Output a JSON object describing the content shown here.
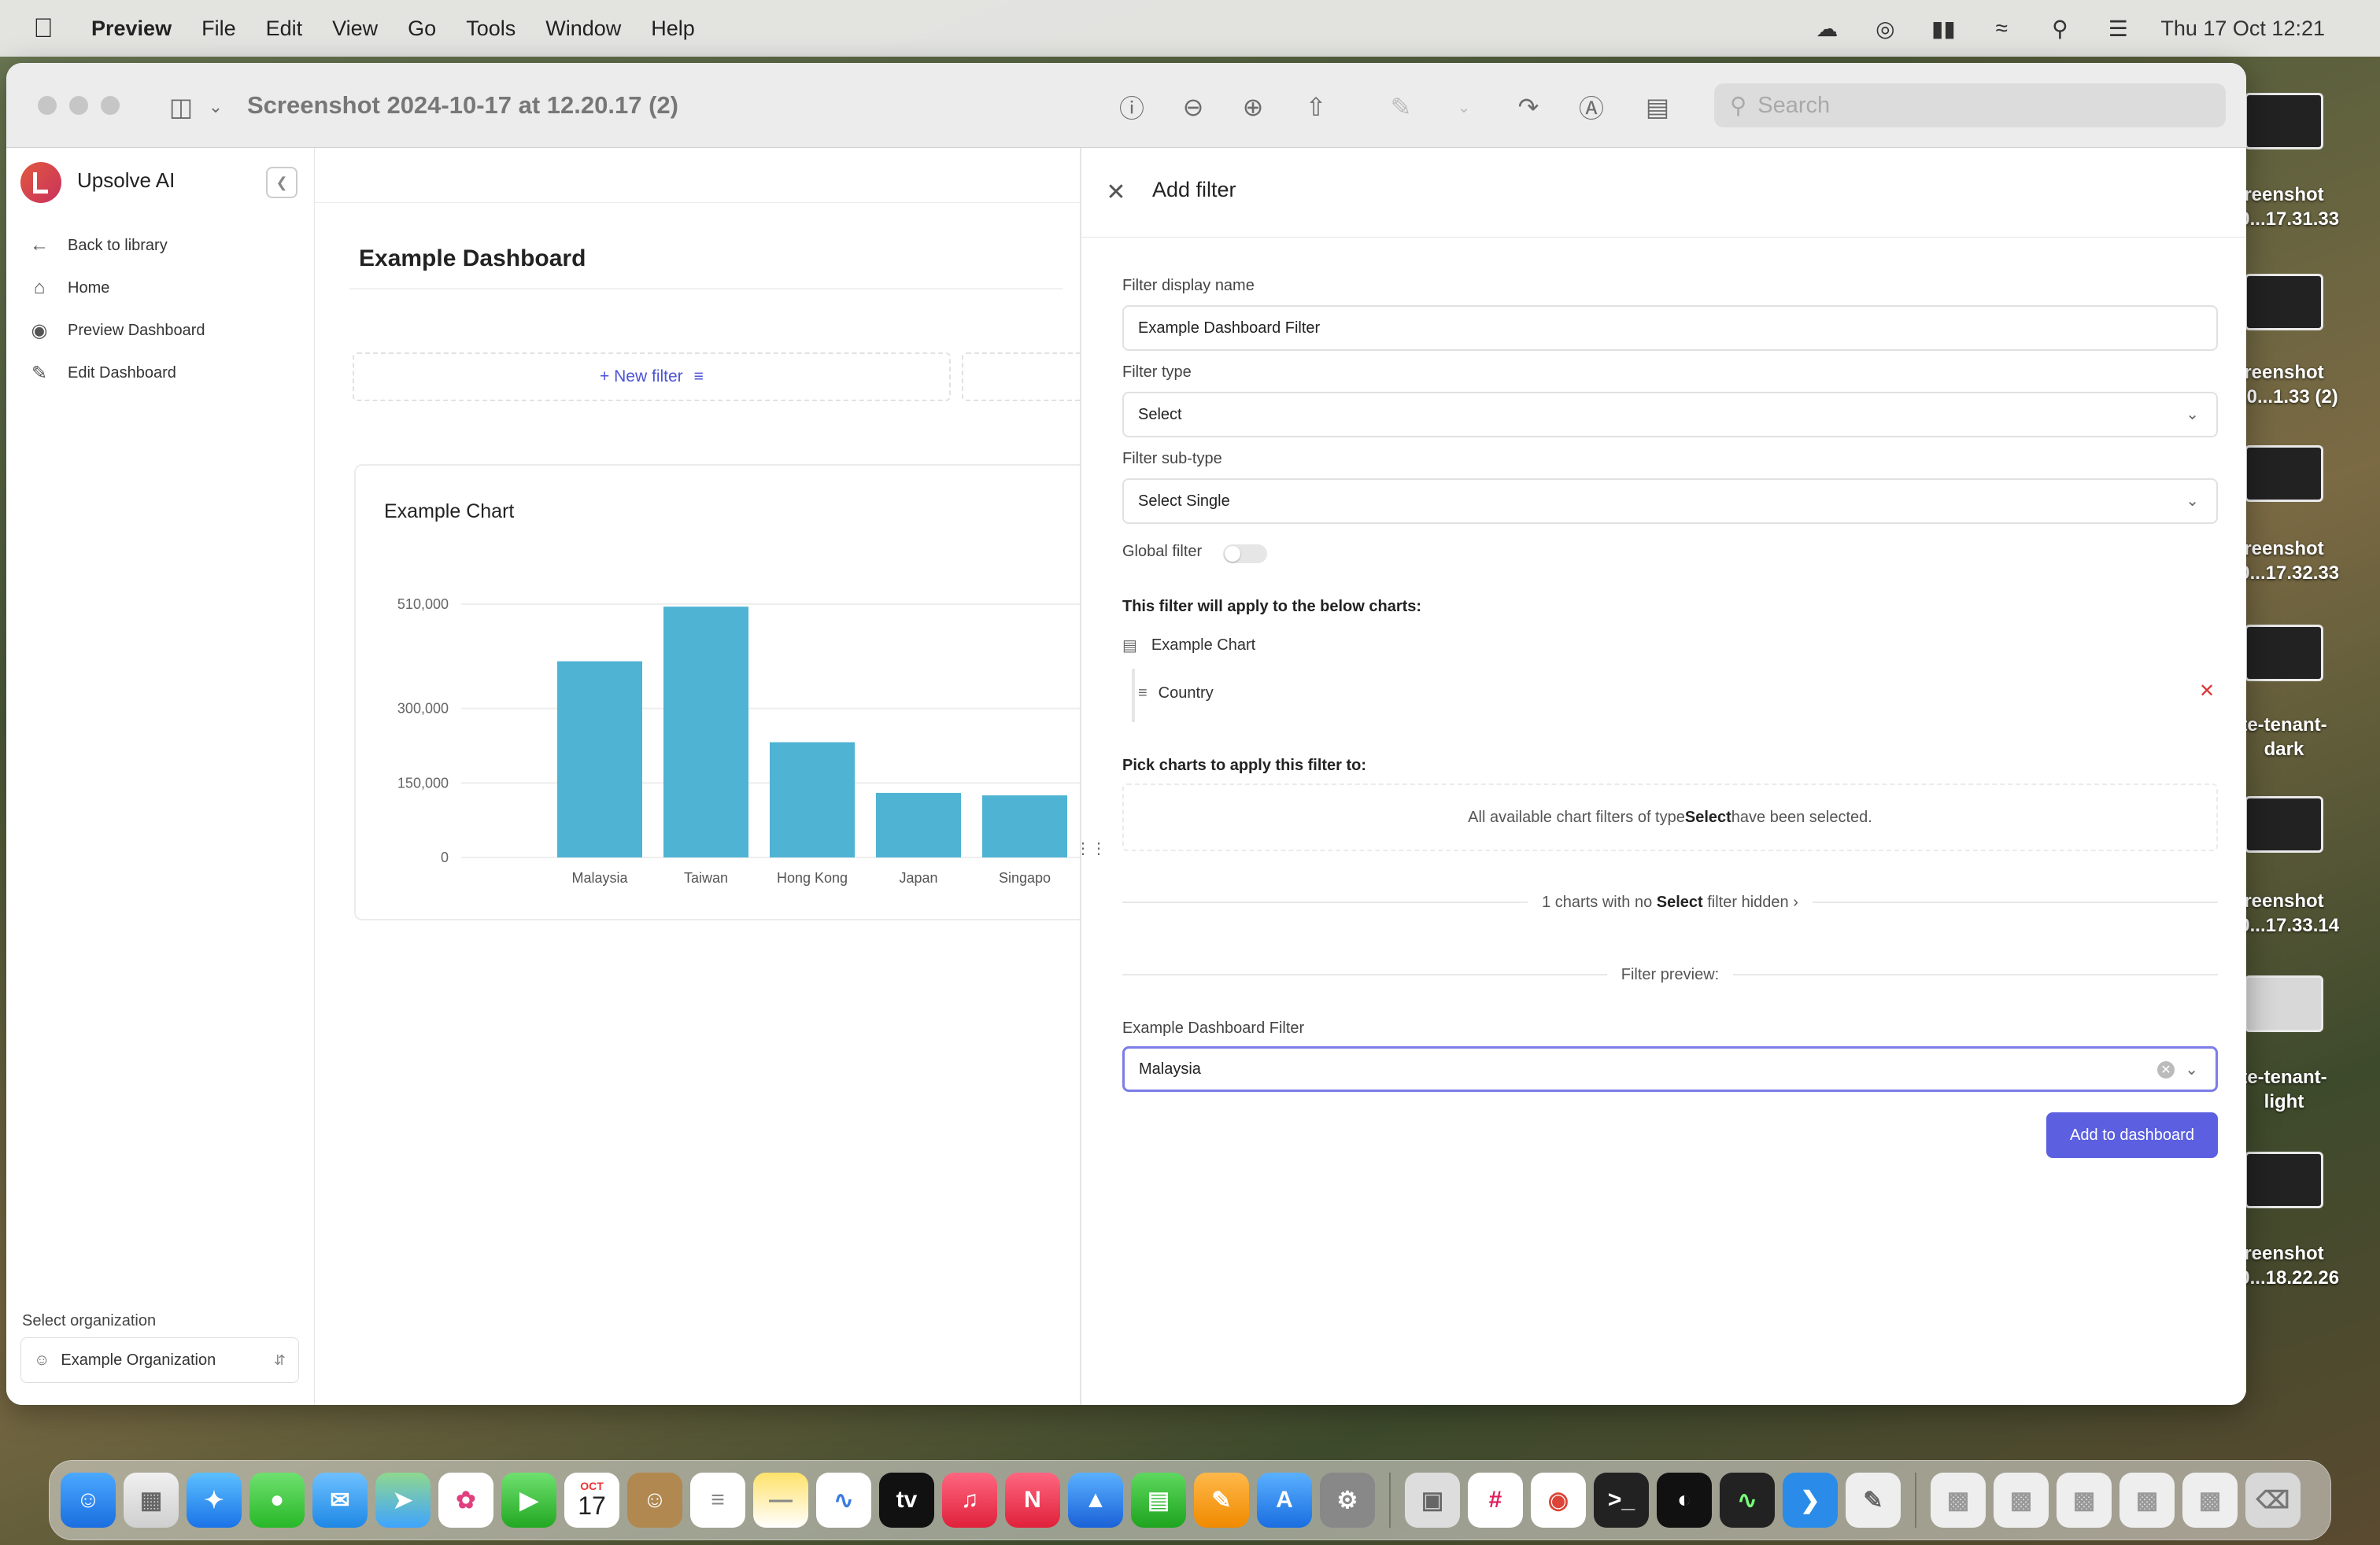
{
  "menubar": {
    "app": "Preview",
    "items": [
      "File",
      "Edit",
      "View",
      "Go",
      "Tools",
      "Window",
      "Help"
    ],
    "clock": "Thu 17 Oct  12:21"
  },
  "window": {
    "title": "Screenshot 2024-10-17 at 12.20.17 (2)",
    "search_placeholder": "Search"
  },
  "sidebar": {
    "brand": "Upsolve AI",
    "items": [
      {
        "label": "Back to library",
        "icon": "arrow-left-icon"
      },
      {
        "label": "Home",
        "icon": "home-icon"
      },
      {
        "label": "Preview Dashboard",
        "icon": "eye-icon"
      },
      {
        "label": "Edit Dashboard",
        "icon": "edit-icon"
      }
    ],
    "org_label": "Select organization",
    "org_value": "Example Organization"
  },
  "main": {
    "dashboard_title": "Example Dashboard",
    "new_filter": "+ New filter"
  },
  "chart_data": {
    "type": "bar",
    "title": "Example Chart",
    "categories": [
      "Malaysia",
      "Taiwan",
      "Hong Kong",
      "Japan",
      "Singapo"
    ],
    "values": [
      395000,
      505000,
      232000,
      130000,
      125000
    ],
    "yticks": [
      "510,000",
      "300,000",
      "150,000",
      "0"
    ],
    "ytick_values": [
      510000,
      300000,
      150000,
      0
    ],
    "ylim": [
      0,
      510000
    ],
    "color": "#4fb3d3"
  },
  "panel": {
    "title": "Add filter",
    "display_name_label": "Filter display name",
    "display_name_value": "Example Dashboard Filter",
    "type_label": "Filter type",
    "type_value": "Select",
    "subtype_label": "Filter sub-type",
    "subtype_value": "Select Single",
    "global_label": "Global filter",
    "applies_heading": "This filter will apply to the below charts:",
    "chart_name": "Example Chart",
    "dimension": "Country",
    "pick_heading": "Pick charts to apply this filter to:",
    "all_selected_pre": "All available chart filters of type ",
    "all_selected_bold": "Select",
    "all_selected_post": " have been selected.",
    "hidden_pre": "1 charts with no ",
    "hidden_bold": "Select",
    "hidden_post": " filter hidden",
    "preview_heading": "Filter preview:",
    "preview_label": "Example Dashboard Filter",
    "preview_value": "Malaysia",
    "add_button": "Add to dashboard"
  },
  "desktop": [
    {
      "label1": "reenshot",
      "label2": "10...17.31.33"
    },
    {
      "label1": "reenshot",
      "label2": "-10...1.33 (2)"
    },
    {
      "label1": "reenshot",
      "label2": "10...17.32.33"
    },
    {
      "label1": "te-tenant-",
      "label2": "dark"
    },
    {
      "label1": "reenshot",
      "label2": "10...17.33.14"
    },
    {
      "label1": "te-tenant-",
      "label2": "light"
    },
    {
      "label1": "reenshot",
      "label2": "10...18.22.26"
    }
  ],
  "dock": {
    "calendar_month": "OCT",
    "calendar_day": "17"
  }
}
